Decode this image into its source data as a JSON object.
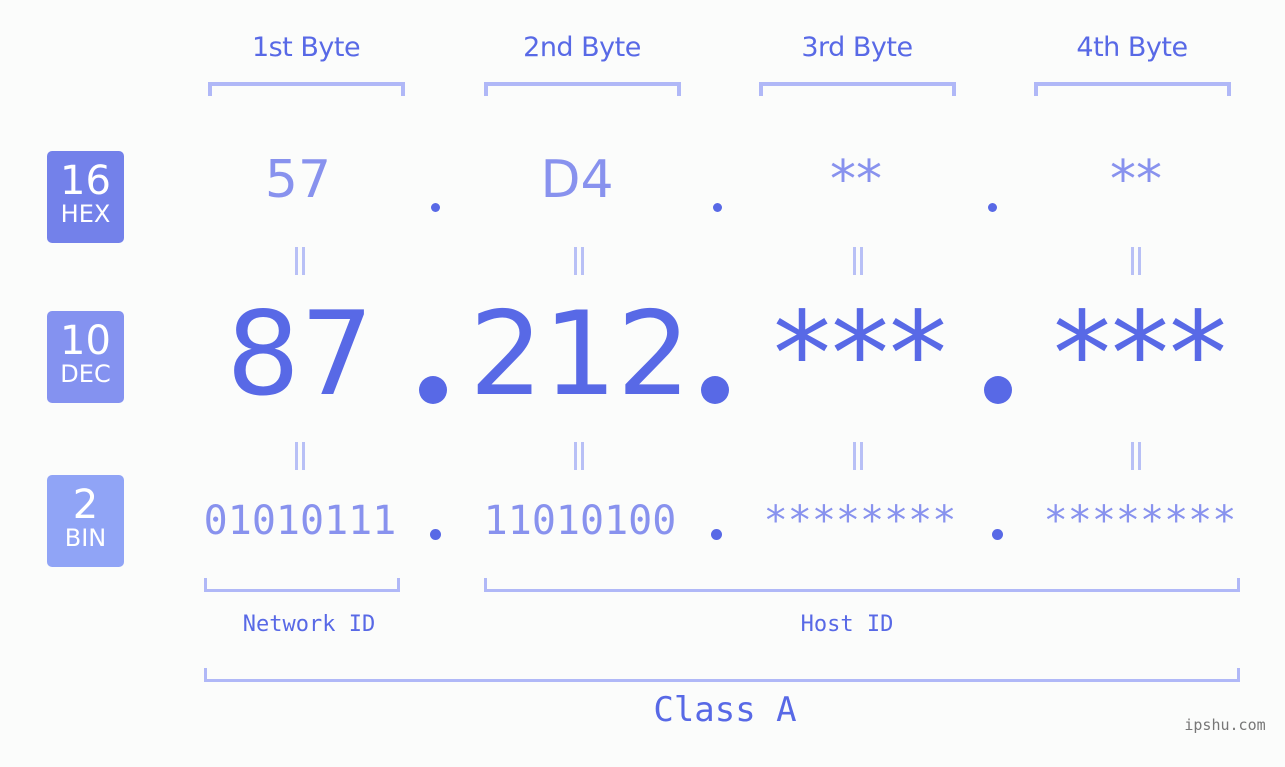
{
  "bytes": {
    "headers": [
      "1st Byte",
      "2nd Byte",
      "3rd Byte",
      "4th Byte"
    ],
    "hex": [
      "57",
      "D4",
      "**",
      "**"
    ],
    "dec": [
      "87",
      "212",
      "***",
      "***"
    ],
    "bin": [
      "01010111",
      "11010100",
      "********",
      "********"
    ]
  },
  "badges": {
    "hex": {
      "num": "16",
      "label": "HEX",
      "color": "#7381ea"
    },
    "dec": {
      "num": "10",
      "label": "DEC",
      "color": "#8492f0"
    },
    "bin": {
      "num": "2",
      "label": "BIN",
      "color": "#90a4f6"
    }
  },
  "segments": {
    "network": "Network ID",
    "host": "Host ID",
    "class": "Class A"
  },
  "watermark": "ipshu.com",
  "colors": {
    "primary": "#5869e6",
    "secondary": "#8892ee",
    "bracket": "#b0b8f7"
  }
}
